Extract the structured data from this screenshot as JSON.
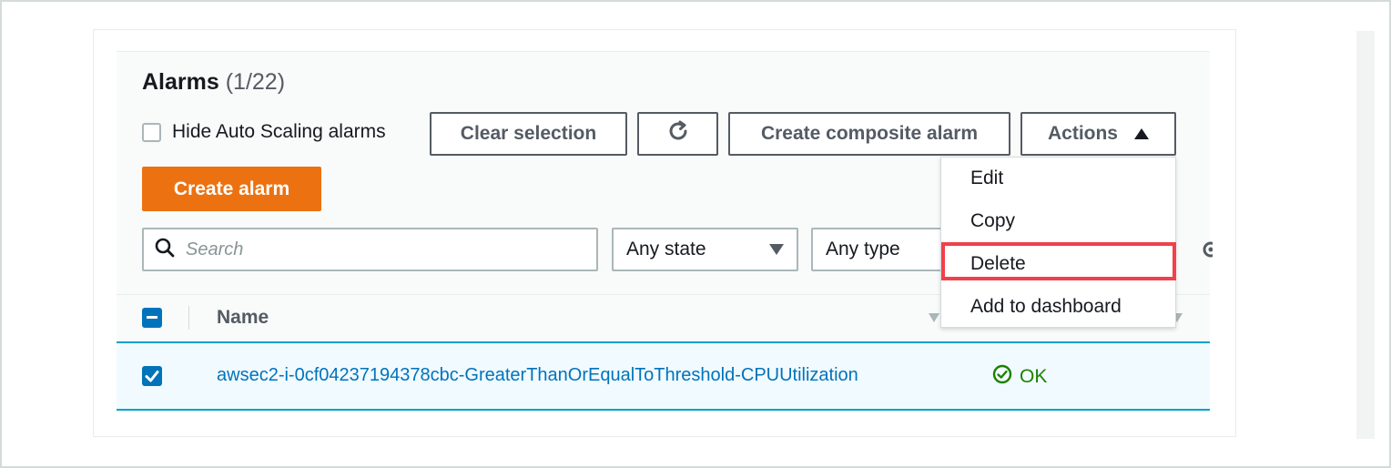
{
  "header": {
    "title": "Alarms",
    "count": "(1/22)"
  },
  "toolbar": {
    "hide_autoscaling_label": "Hide Auto Scaling alarms",
    "clear_selection_label": "Clear selection",
    "create_composite_label": "Create composite alarm",
    "actions_label": "Actions",
    "create_alarm_label": "Create alarm"
  },
  "filters": {
    "search_placeholder": "Search",
    "state_value": "Any state",
    "type_value": "Any type"
  },
  "table": {
    "columns": [
      "Name"
    ],
    "rows": [
      {
        "name": "awsec2-i-0cf04237194378cbc-GreaterThanOrEqualToThreshold-CPUUtilization",
        "state": "OK",
        "selected": true
      }
    ]
  },
  "actions_menu": {
    "items": [
      "Edit",
      "Copy",
      "Delete",
      "Add to dashboard"
    ],
    "highlighted": "Delete"
  },
  "colors": {
    "primary_button": "#ec7211",
    "link": "#0073bb",
    "ok_status": "#1d8102",
    "highlight_box": "#f0414c",
    "selected_row_border": "#00a1c9"
  }
}
